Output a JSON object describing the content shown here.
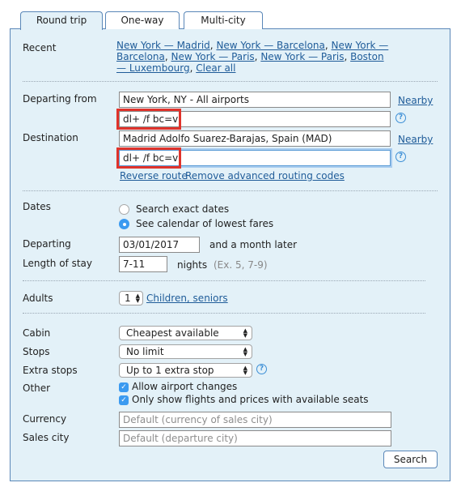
{
  "tabs": [
    {
      "label": "Round trip",
      "active": true
    },
    {
      "label": "One-way",
      "active": false
    },
    {
      "label": "Multi-city",
      "active": false
    }
  ],
  "recent": {
    "label": "Recent",
    "links": [
      "New York — Madrid",
      "New York — Barcelona",
      "New York — Barcelona",
      "New York — Paris",
      "New York — Paris",
      "Boston — Luxembourg"
    ],
    "clear_all": "Clear all"
  },
  "route": {
    "departing_label": "Departing from",
    "departing_value": "New York, NY - All airports",
    "departing_code": "dl+ /f bc=v",
    "nearby_label": "Nearby",
    "destination_label": "Destination",
    "destination_value": "Madrid Adolfo Suarez-Barajas, Spain (MAD)",
    "destination_code": "dl+ /f bc=v",
    "reverse_route": "Reverse route",
    "remove_codes": "Remove advanced routing codes",
    "help_glyph": "?"
  },
  "dates": {
    "label": "Dates",
    "options": [
      {
        "label": "Search exact dates",
        "checked": false
      },
      {
        "label": "See calendar of lowest fares",
        "checked": true
      }
    ],
    "departing_label": "Departing",
    "departing_value": "03/01/2017",
    "departing_suffix": "and a month later",
    "stay_label": "Length of stay",
    "stay_value": "7-11",
    "stay_unit": "nights",
    "stay_hint": "(Ex. 5, 7-9)"
  },
  "passengers": {
    "adults_label": "Adults",
    "adults_value": "1",
    "children_link": "Children, seniors"
  },
  "options": {
    "cabin_label": "Cabin",
    "cabin_value": "Cheapest available",
    "stops_label": "Stops",
    "stops_value": "No limit",
    "extra_stops_label": "Extra stops",
    "extra_stops_value": "Up to 1 extra stop",
    "other_label": "Other",
    "checkboxes": [
      {
        "label": "Allow airport changes",
        "checked": true
      },
      {
        "label": "Only show flights and prices with available seats",
        "checked": true
      }
    ],
    "currency_label": "Currency",
    "currency_placeholder": "Default (currency of sales city)",
    "sales_city_label": "Sales city",
    "sales_city_placeholder": "Default (departure city)"
  },
  "search_button": "Search",
  "colors": {
    "panel_bg": "#e3f1f8",
    "border": "#5a87b8",
    "link": "#1f5c99",
    "highlight": "#e0332b",
    "accent": "#3b9af0"
  }
}
